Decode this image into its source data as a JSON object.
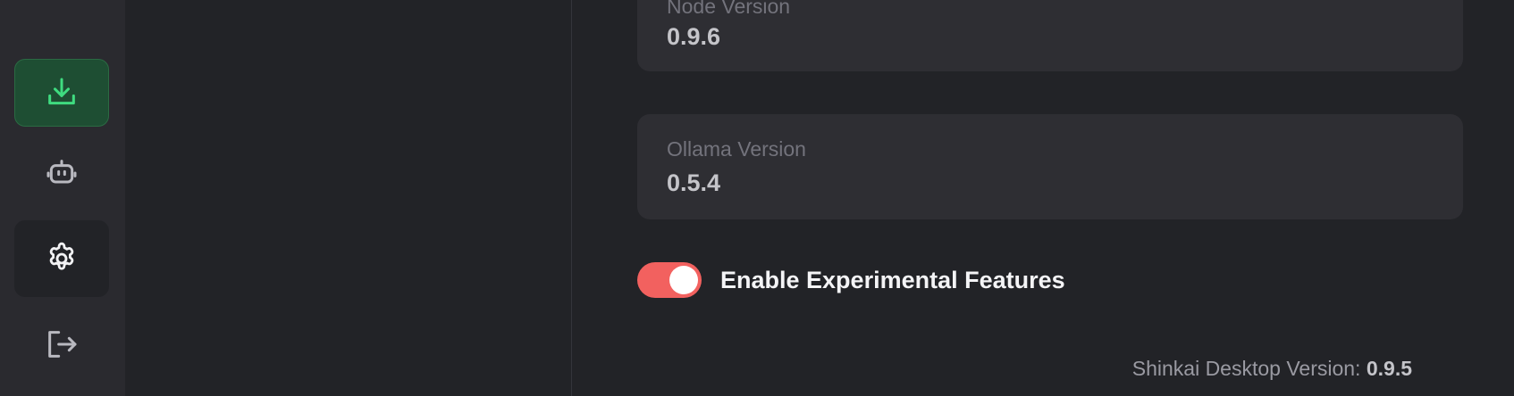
{
  "sidebar": {
    "items": [
      {
        "name": "download",
        "icon": "download-icon",
        "active": false,
        "color": "#3fdc80"
      },
      {
        "name": "agents",
        "icon": "robot-icon",
        "active": false
      },
      {
        "name": "settings",
        "icon": "gear-icon",
        "active": true
      },
      {
        "name": "logout",
        "icon": "logout-icon",
        "active": false
      }
    ]
  },
  "settings": {
    "node_version": {
      "label": "Node Version",
      "value": "0.9.6"
    },
    "ollama_version": {
      "label": "Ollama Version",
      "value": "0.5.4"
    },
    "experimental": {
      "label": "Enable Experimental Features",
      "enabled": true,
      "color": "#f2615f"
    },
    "app_version": {
      "label": "Shinkai Desktop Version:",
      "value": "0.9.5"
    }
  }
}
